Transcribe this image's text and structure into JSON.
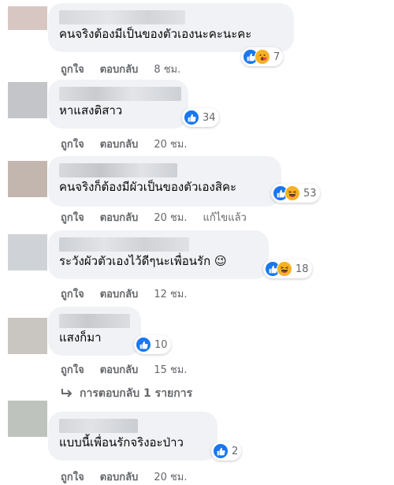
{
  "actions": {
    "like": "ถูกใจ",
    "reply": "ตอบกลับ"
  },
  "colors": {
    "like_blue": "#1877f2",
    "haha_yellow": "#f7b125",
    "bubble_bg": "#f0f2f5"
  },
  "comments": [
    {
      "text": "คนจริงต้องมีเป็นของตัวเองนะคะนะคะ",
      "reaction_count": "7",
      "reactions": [
        "like-icon",
        "wow-love-icon"
      ],
      "time": "8 ชม.",
      "edited": ""
    },
    {
      "text": "หาแสงติสาว",
      "reaction_count": "34",
      "reactions": [
        "like-icon"
      ],
      "time": "20 ชม.",
      "edited": ""
    },
    {
      "text": "คนจริงก็ต้องมีผัวเป็นของตัวเองสิคะ",
      "reaction_count": "53",
      "reactions": [
        "like-icon",
        "haha-icon"
      ],
      "time": "20 ชม.",
      "edited": "แก้ไขแล้ว"
    },
    {
      "text": "ระวังผัวตัวเองไว้ดีๆนะเพื่อนรัก 😉",
      "reaction_count": "18",
      "reactions": [
        "like-icon",
        "haha-icon"
      ],
      "time": "12 ชม.",
      "edited": ""
    },
    {
      "text": "แสงก็มา",
      "reaction_count": "10",
      "reactions": [
        "like-icon"
      ],
      "time": "15 ชม.",
      "edited": ""
    },
    {
      "text": "แบบนี้เพื่อนรักจริงอะป่าว",
      "reaction_count": "2",
      "reactions": [
        "like-icon"
      ],
      "time": "20 ชม.",
      "edited": ""
    }
  ],
  "replies_link": "การตอบกลับ 1 รายการ"
}
